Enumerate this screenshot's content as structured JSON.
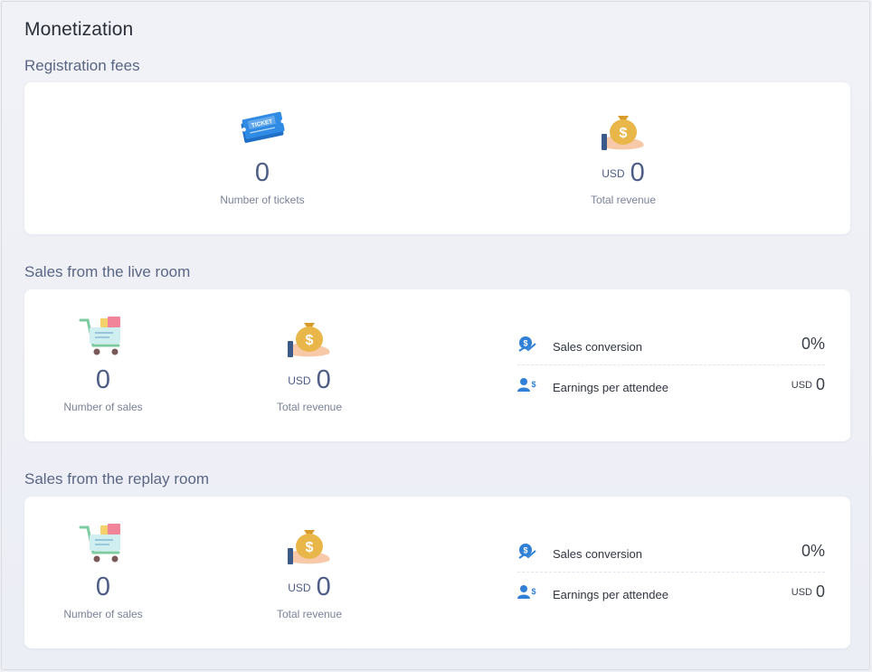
{
  "page": {
    "title": "Monetization"
  },
  "registration": {
    "title": "Registration fees",
    "tickets": {
      "value": "0",
      "label": "Number of tickets",
      "icon": "ticket-icon"
    },
    "revenue": {
      "currency": "USD",
      "value": "0",
      "label": "Total revenue",
      "icon": "money-bag-icon"
    }
  },
  "live": {
    "title": "Sales from the live room",
    "sales": {
      "value": "0",
      "label": "Number of sales",
      "icon": "shopping-cart-icon"
    },
    "revenue": {
      "currency": "USD",
      "value": "0",
      "label": "Total revenue",
      "icon": "money-bag-icon"
    },
    "conversion": {
      "label": "Sales conversion",
      "value": "0%",
      "icon": "sales-conversion-icon"
    },
    "earnings": {
      "label": "Earnings per attendee",
      "currency": "USD",
      "value": "0",
      "icon": "earnings-attendee-icon"
    }
  },
  "replay": {
    "title": "Sales from the replay room",
    "sales": {
      "value": "0",
      "label": "Number of sales",
      "icon": "shopping-cart-icon"
    },
    "revenue": {
      "currency": "USD",
      "value": "0",
      "label": "Total revenue",
      "icon": "money-bag-icon"
    },
    "conversion": {
      "label": "Sales conversion",
      "value": "0%",
      "icon": "sales-conversion-icon"
    },
    "earnings": {
      "label": "Earnings per attendee",
      "currency": "USD",
      "value": "0",
      "icon": "earnings-attendee-icon"
    }
  },
  "colors": {
    "value_text": "#4d5d86",
    "section_title": "#5b6684",
    "icon_blue": "#2f80d6",
    "bag_gold": "#e9b64a",
    "cart_green": "#7ecba1"
  }
}
